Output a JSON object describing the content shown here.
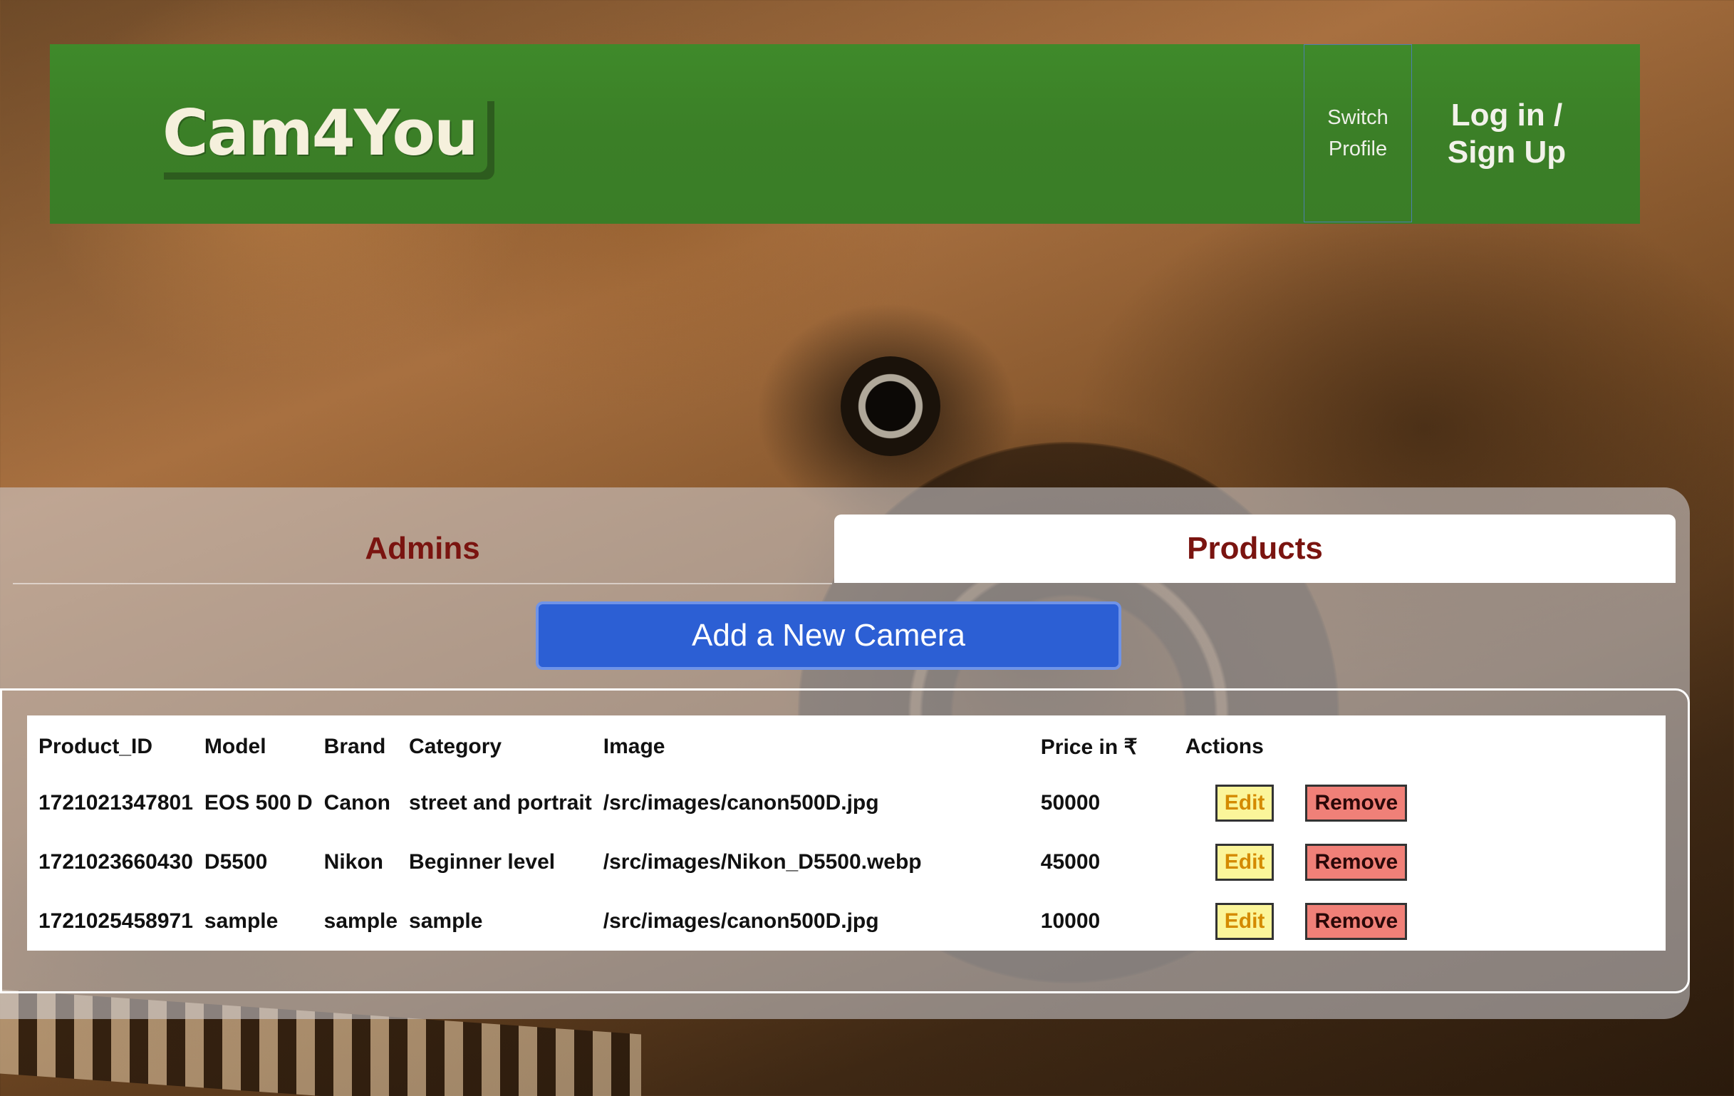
{
  "header": {
    "logo": "Cam4You",
    "switch_profile": "Switch Profile",
    "login": "Log in / Sign Up"
  },
  "tabs": [
    {
      "label": "Admins",
      "active": false
    },
    {
      "label": "Products",
      "active": true
    }
  ],
  "add_button": "Add a New Camera",
  "table": {
    "columns": [
      "Product_ID",
      "Model",
      "Brand",
      "Category",
      "Image",
      "Price in ₹",
      "Actions"
    ],
    "rows": [
      {
        "id": "1721021347801",
        "model": "EOS 500 D",
        "brand": "Canon",
        "category": "street and portrait",
        "image": "/src/images/canon500D.jpg",
        "price": "50000"
      },
      {
        "id": "1721023660430",
        "model": "D5500",
        "brand": "Nikon",
        "category": "Beginner level",
        "image": "/src/images/Nikon_D5500.webp",
        "price": "45000"
      },
      {
        "id": "1721025458971",
        "model": "sample",
        "brand": "sample",
        "category": "sample",
        "image": "/src/images/canon500D.jpg",
        "price": "10000"
      }
    ],
    "edit_label": "Edit",
    "remove_label": "Remove"
  },
  "colors": {
    "header_bg": "#3b7f27",
    "tab_text": "#7a1410",
    "add_button_bg": "#2c5fd4",
    "edit_bg": "#fbf59a",
    "remove_bg": "#f08078"
  }
}
